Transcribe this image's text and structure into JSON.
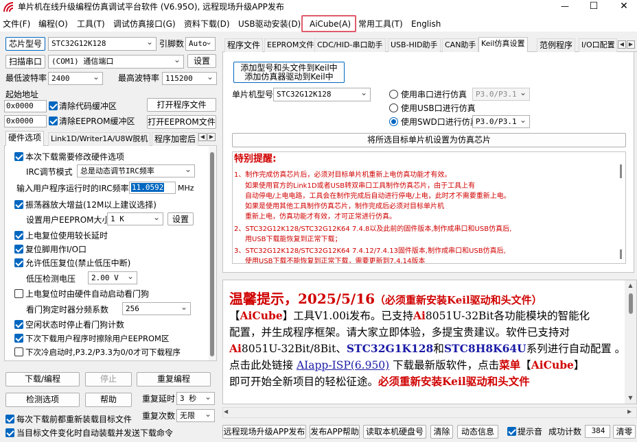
{
  "window": {
    "title": "单片机在线升级编程仿真调试平台软件 (V6.95O), 远程现场升级APP发布",
    "min_symbol": "—",
    "max_symbol": "☐",
    "close_symbol": "✕"
  },
  "menu": {
    "items": [
      "文件(F)",
      "编程(O)",
      "工具(T)",
      "调试仿真接口(G)",
      "资料下载(D)",
      "USB驱动安装(D)",
      "AiCube(A)",
      "常用工具(T)",
      "English"
    ]
  },
  "left": {
    "chip_model_button": "芯片型号",
    "chip_model_value": "STC32G12K128",
    "pin_count_label": "引脚数",
    "pin_count_value": "Auto",
    "scan_port_button": "扫描串口",
    "port_value": "(COM1) 通信端口",
    "settings_button": "设置",
    "min_baud_label": "最低波特率",
    "min_baud_value": "2400",
    "max_baud_label": "最高波特率",
    "max_baud_value": "115200",
    "start_addr_label": "起始地址",
    "code_addr_value": "0x0000",
    "clear_code_buffer": "清除代码缓冲区",
    "open_program_button": "打开程序文件",
    "eeprom_addr_value": "0x0000",
    "clear_eeprom_buffer": "清除EEPROM缓冲区",
    "open_eeprom_button": "打开EEPROM文件",
    "tabs": [
      "硬件选项",
      "Link1D/Writer1A/U8W脱机",
      "程序加密后"
    ],
    "hw": {
      "modify_hw_options": "本次下载需要修改硬件选项",
      "irc_mode_label": "IRC调节模式",
      "irc_mode_value": "总是动态调节IRC频率",
      "irc_freq_label": "输入用户程序运行时的IRC频率",
      "irc_freq_value": "11.0592",
      "irc_freq_unit": "MHz",
      "osc_gain": "振荡器放大增益(12M以上建议选择)",
      "eeprom_size_label": "设置用户EEPROM大小",
      "eeprom_size_value": "1  K",
      "eeprom_set_button": "设置",
      "long_reset_delay": "上电复位使用较长延时",
      "reset_pin_io": "复位脚用作I/O口",
      "low_voltage_reset": "允许低压复位(禁止低压中断)",
      "lv_detect_label": "低压检测电压",
      "lv_detect_value": "2.00 V",
      "wdt_on_reset": "上电复位时由硬件自动启动看门狗",
      "wdt_prescale_label": "看门狗定时器分频系数",
      "wdt_prescale_value": "256",
      "idle_stop_wdt": "空闲状态时停止看门狗计数",
      "no_erase_eeprom": "下次下载用户程序时擦除用户EEPROM区",
      "cold_boot_p32p33": "下次冷启动时,P3.2/P3.3为0/0才可下载程序"
    },
    "download_button": "下载/编程",
    "stop_button": "停止",
    "reprogram_button": "重复编程",
    "check_options_button": "检测选项",
    "help_button": "帮助",
    "repeat_delay_label": "重复延时",
    "repeat_delay_value": "3 秒",
    "repeat_count_label": "重复次数",
    "repeat_count_value": "无限",
    "reload_each": "每次下载前都重新装载目标文件",
    "auto_reload": "当目标文件变化时自动装载并发送下载命令"
  },
  "right": {
    "tabs": [
      "程序文件",
      "EEPROM文件",
      "CDC/HID-串口助手",
      "USB-HID助手",
      "CAN助手",
      "Keil仿真设置",
      "范例程序",
      "I/O口配置"
    ],
    "active_tab": "Keil仿真设置",
    "add_model_button_line1": "添加型号和头文件到Keil中",
    "add_model_button_line2": "添加仿真器驱动到Keil中",
    "mcu_model_label": "单片机型号",
    "mcu_model_value": "STC32G12K128",
    "radio_serial": "使用串口进行仿真",
    "radio_serial_port": "P3.0/P3.1",
    "radio_usb": "使用USB口进行仿真",
    "radio_swd": "使用SWD口进行仿真",
    "radio_swd_port": "P3.0/P3.1",
    "set_emulator_button": "将所选目标单片机设置为仿真芯片",
    "notice_title": "特别提醒:",
    "notice_lines": [
      "1、制作完成仿真芯片后，必须对目标单片机重新上电仿真功能才有效。",
      "如果使用官方的Link1D或者USB转双串口工具制作仿真芯片，由于工具上有",
      "自动停电/上电电路，工具会在制作完成后自动进行停电/上电，此时才不需要重新上电。",
      "如果是使用其他工具制作仿真芯片，制作完成后必须对目标单片机",
      "重新上电，仿真功能才有效，才可正常进行仿真。",
      "2、STC32G12K128/STC32G12K64  7.4.8以及此前的固件版本,制作成串口和USB仿真后,",
      "用USB下载能恢复到正常下载；",
      "3、STC32G12K128/STC32G12K64  7.4.12/7.4.13固件版本,制作成串口和USB仿真后,",
      "使用USB下载不能恢复到正常下载，需要更新到7.4.14版本"
    ]
  },
  "announcement": {
    "heading": "温馨提示，2025/5/16",
    "heading_note": "（必须重新安装Keil驱动和头文件）",
    "l2_b1": "【",
    "l2_aicube": "AiCube",
    "l2_b2": "】",
    "l2_rest1": "工具V1.00i发布。已支持",
    "l2_ai": "Ai",
    "l2_rest2": "8051U-32Bit各功能模块的智能化",
    "l3": "配置，并生成程序框架。请大家立即体验，多提宝贵建议。软件已支持对",
    "l4_ai": "Ai",
    "l4_a": "8051U-32Bit/8Bit、",
    "l4_stc1": "STC32G1K128",
    "l4_and": "和",
    "l4_stc2": "STC8H8K64U",
    "l4_b": "系列进行自动配置 。",
    "l5_a": "点击此处链接 ",
    "l5_link": "AIapp-ISP(6.950)",
    "l5_b": " 下载最新版软件，点击",
    "l5_menu": "菜单",
    "l5_b1": "【",
    "l5_aicube": "AiCube",
    "l5_b2": "】",
    "l6_a": "即可开始全新项目的轻松征途。",
    "l6_b": "必须重新安装Keil驱动和头文件"
  },
  "bottom": {
    "remote_upgrade_button": "远程现场升级APP发布",
    "publish_help_button": "发布APP帮助",
    "read_disk_button": "读取本机硬盘号",
    "clear_button": "清除",
    "dynamic_info_button": "动态信息",
    "beep_label": "提示音",
    "success_count_label": "成功计数",
    "success_count_value": "384",
    "clear_count_button": "清零"
  },
  "colors": {
    "highlight_border": "#e05a6a",
    "accent_blue": "#0067c0",
    "notice_red": "#d00000"
  }
}
